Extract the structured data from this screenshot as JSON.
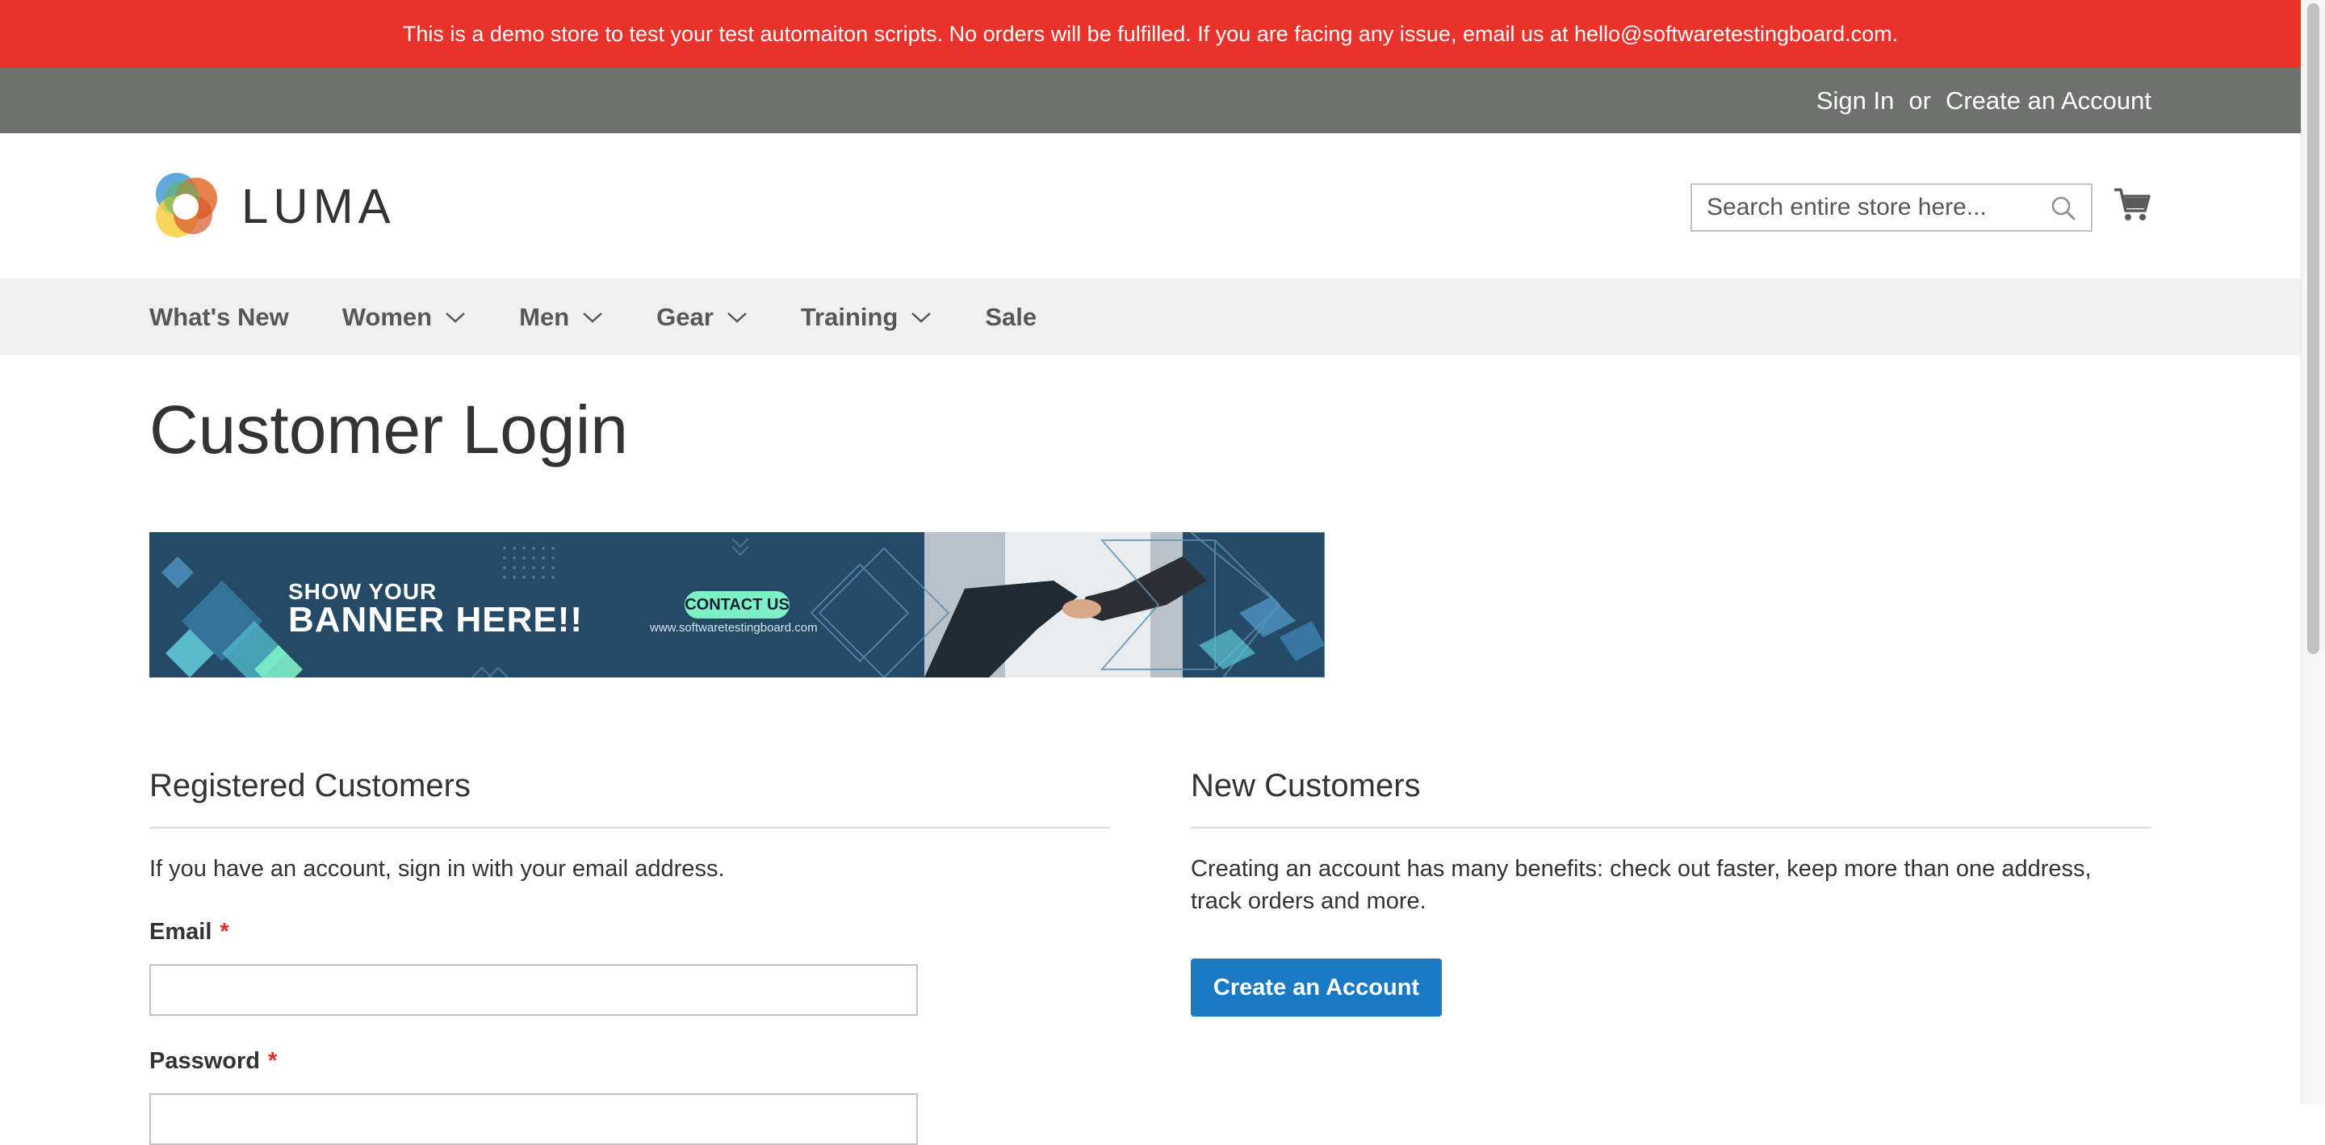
{
  "demo_notice": "This is a demo store to test your test automaiton scripts. No orders will be fulfilled. If you are facing any issue, email us at hello@softwaretestingboard.com.",
  "header": {
    "sign_in": "Sign In",
    "or": "or",
    "create_account": "Create an Account"
  },
  "logo": {
    "text": "LUMA"
  },
  "search": {
    "placeholder": "Search entire store here...",
    "value": ""
  },
  "nav": {
    "items": [
      {
        "label": "What's New"
      },
      {
        "label": "Women"
      },
      {
        "label": "Men"
      },
      {
        "label": "Gear"
      },
      {
        "label": "Training"
      },
      {
        "label": "Sale"
      }
    ]
  },
  "page": {
    "title": "Customer Login"
  },
  "banner": {
    "line1": "SHOW YOUR",
    "line2": "BANNER HERE!!",
    "contact": "CONTACT US",
    "url": "www.softwaretestingboard.com"
  },
  "registered": {
    "title": "Registered Customers",
    "intro": "If you have an account, sign in with your email address.",
    "email_label": "Email",
    "email_value": "",
    "password_label": "Password",
    "password_value": "",
    "required_mark": "*"
  },
  "new_customers": {
    "title": "New Customers",
    "text": "Creating an account has many benefits: check out faster, keep more than one address, track orders and more.",
    "button": "Create an Account"
  },
  "colors": {
    "notice_bg": "#e8322a",
    "header_bg": "#6e716e",
    "nav_bg": "#f0f0f0",
    "primary_button": "#1979c3",
    "required": "#e02b27"
  }
}
